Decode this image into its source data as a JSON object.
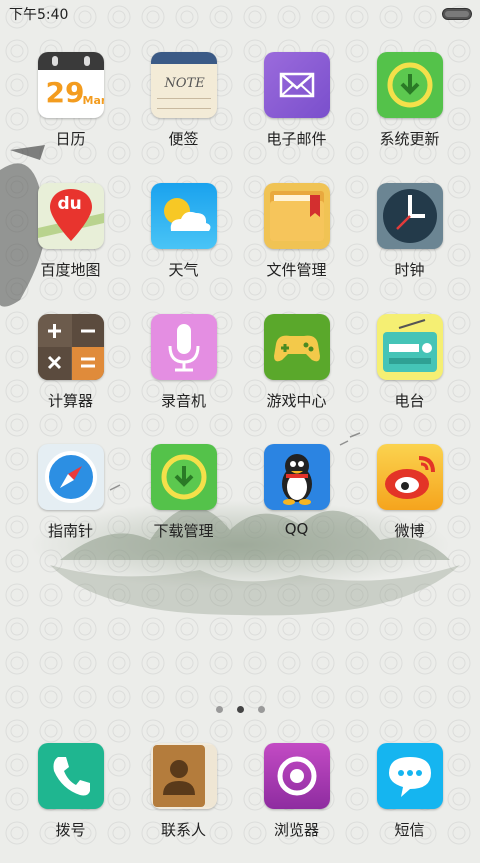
{
  "status_bar": {
    "time": "下午5:40"
  },
  "apps": {
    "calendar": {
      "label": "日历",
      "day": "29",
      "month": "Mar"
    },
    "notes": {
      "label": "便签",
      "note_text": "NOTE"
    },
    "email": {
      "label": "电子邮件"
    },
    "system_update": {
      "label": "系统更新"
    },
    "baidu_maps": {
      "label": "百度地图",
      "logo_text": "du"
    },
    "weather": {
      "label": "天气"
    },
    "file_manager": {
      "label": "文件管理"
    },
    "clock": {
      "label": "时钟"
    },
    "calculator": {
      "label": "计算器"
    },
    "recorder": {
      "label": "录音机"
    },
    "game_center": {
      "label": "游戏中心"
    },
    "radio": {
      "label": "电台"
    },
    "compass": {
      "label": "指南针"
    },
    "download_manager": {
      "label": "下载管理"
    },
    "qq": {
      "label": "QQ"
    },
    "weibo": {
      "label": "微博"
    }
  },
  "dock": {
    "dialer": {
      "label": "拨号"
    },
    "contacts": {
      "label": "联系人"
    },
    "browser": {
      "label": "浏览器"
    },
    "messages": {
      "label": "短信"
    }
  },
  "page_indicator": {
    "count": 3,
    "active_index": 1
  }
}
